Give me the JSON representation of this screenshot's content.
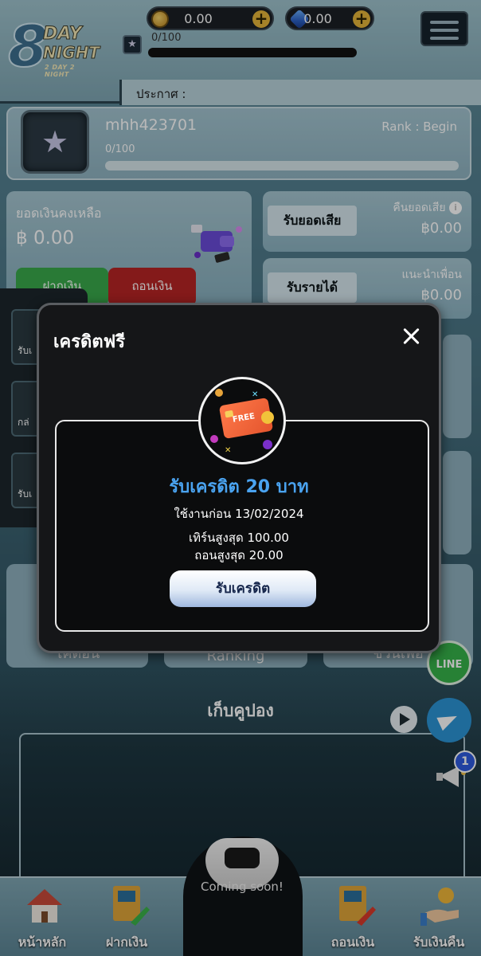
{
  "header": {
    "logo": "8 DAY NIGHT",
    "logo_sub": "2 DAY 2 NIGHT",
    "coins": "0.00",
    "gems": "0.00",
    "xp": "0/100",
    "announcement_label": "ประกาศ :"
  },
  "profile": {
    "username": "mhh423701",
    "rank": "Rank : Begin",
    "xp": "0/100"
  },
  "balance": {
    "label": "ยอดเงินคงเหลือ",
    "value": "฿ 0.00",
    "deposit": "ฝากเงิน",
    "withdraw": "ถอนเงิน"
  },
  "side_cards": [
    {
      "tag": "รับยอดเสีย",
      "label": "คืนยอดเสีย",
      "amount": "฿0.00"
    },
    {
      "tag": "รับรายได้",
      "label": "แนะนำเพื่อน",
      "amount": "฿0.00"
    }
  ],
  "left_panel": [
    "รับเ",
    "กล่",
    "รับเ"
  ],
  "tiles": [
    "โค้ดอัน",
    "Ranking",
    "ชวนเพื่อ"
  ],
  "coupon_section": {
    "title": "เก็บคูปอง"
  },
  "fab": {
    "line": "LINE",
    "promo_count": "1"
  },
  "bottom_nav": {
    "items": [
      "หน้าหลัก",
      "ฝากเงิน",
      "ถอนเงิน",
      "รับเงินคืน"
    ],
    "coming_soon": "Coming soon!"
  },
  "modal": {
    "title": "เครดิตฟรี",
    "card_text": "FREE",
    "reward_title": "รับเครดิต 20 บาท",
    "expire": "ใช้งานก่อน 13/02/2024",
    "turn_max": "เทิร์นสูงสุด 100.00",
    "withdraw_max": "ถอนสูงสุด 20.00",
    "claim_button": "รับเครดิต"
  },
  "colors": {
    "accent_blue": "#4aa3f0",
    "deposit_green": "#3aa94c",
    "withdraw_red": "#b82424",
    "line_green": "#37b34a",
    "telegram_blue": "#2b95d6"
  }
}
